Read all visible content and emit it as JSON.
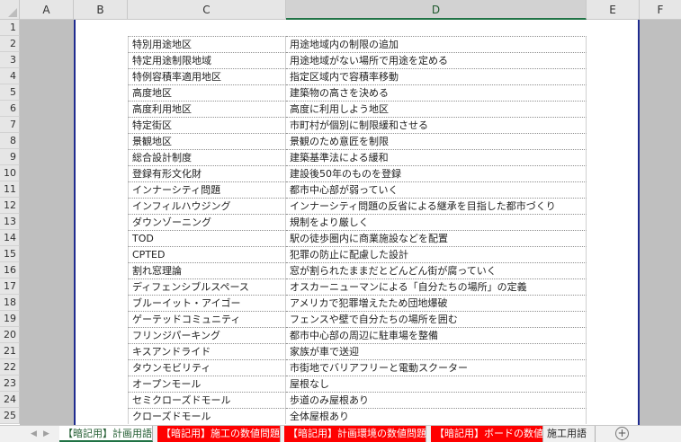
{
  "columns": [
    "A",
    "B",
    "C",
    "D",
    "E",
    "F"
  ],
  "selected_column": "D",
  "rows": [
    {
      "num": "1",
      "term": "",
      "desc": ""
    },
    {
      "num": "2",
      "term": "特別用途地区",
      "desc": "用途地域内の制限の追加"
    },
    {
      "num": "3",
      "term": "特定用途制限地域",
      "desc": "用途地域がない場所で用途を定める"
    },
    {
      "num": "4",
      "term": "特例容積率適用地区",
      "desc": "指定区域内で容積率移動"
    },
    {
      "num": "5",
      "term": "高度地区",
      "desc": "建築物の高さを決める"
    },
    {
      "num": "6",
      "term": "高度利用地区",
      "desc": "高度に利用しよう地区"
    },
    {
      "num": "7",
      "term": "特定街区",
      "desc": "市町村が個別に制限緩和させる"
    },
    {
      "num": "8",
      "term": "景観地区",
      "desc": "景観のため意匠を制限"
    },
    {
      "num": "9",
      "term": "総合設計制度",
      "desc": "建築基準法による緩和"
    },
    {
      "num": "10",
      "term": "登録有形文化財",
      "desc": "建設後50年のものを登録"
    },
    {
      "num": "11",
      "term": "インナーシティ問題",
      "desc": "都市中心部が弱っていく"
    },
    {
      "num": "12",
      "term": "インフィルハウジング",
      "desc": "インナーシティ問題の反省による継承を目指した都市づくり"
    },
    {
      "num": "13",
      "term": "ダウンゾーニング",
      "desc": "規制をより厳しく"
    },
    {
      "num": "14",
      "term": "TOD",
      "desc": "駅の徒歩圏内に商業施設などを配置"
    },
    {
      "num": "15",
      "term": "CPTED",
      "desc": "犯罪の防止に配慮した設計"
    },
    {
      "num": "16",
      "term": "割れ窓理論",
      "desc": "窓が割られたままだとどんどん街が腐っていく"
    },
    {
      "num": "17",
      "term": "ディフェンシブルスペース",
      "desc": "オスカーニューマンによる「自分たちの場所」の定義"
    },
    {
      "num": "18",
      "term": "ブルーイット・アイゴー",
      "desc": "アメリカで犯罪増えたため団地爆破"
    },
    {
      "num": "19",
      "term": "ゲーテッドコミュニティ",
      "desc": "フェンスや壁で自分たちの場所を囲む"
    },
    {
      "num": "20",
      "term": "フリンジパーキング",
      "desc": "都市中心部の周辺に駐車場を整備"
    },
    {
      "num": "21",
      "term": "キスアンドライド",
      "desc": "家族が車で送迎"
    },
    {
      "num": "22",
      "term": "タウンモビリティ",
      "desc": "市街地でバリアフリーと電動スクーター"
    },
    {
      "num": "23",
      "term": "オープンモール",
      "desc": "屋根なし"
    },
    {
      "num": "24",
      "term": "セミクローズドモール",
      "desc": "歩道のみ屋根あり"
    },
    {
      "num": "25",
      "term": "クローズドモール",
      "desc": "全体屋根あり"
    }
  ],
  "tabs": [
    {
      "label": "【暗記用】計画用語",
      "style": "active"
    },
    {
      "label": "【暗記用】施工の数値問題",
      "style": "red"
    },
    {
      "label": "【暗記用】計画環境の数値問題",
      "style": "red"
    },
    {
      "label": "【暗記用】ボードの数値",
      "style": "red"
    },
    {
      "label": "施工用語",
      "style": "plain"
    }
  ],
  "nav": {
    "prev": "◀",
    "next": "▶",
    "add": "+"
  }
}
